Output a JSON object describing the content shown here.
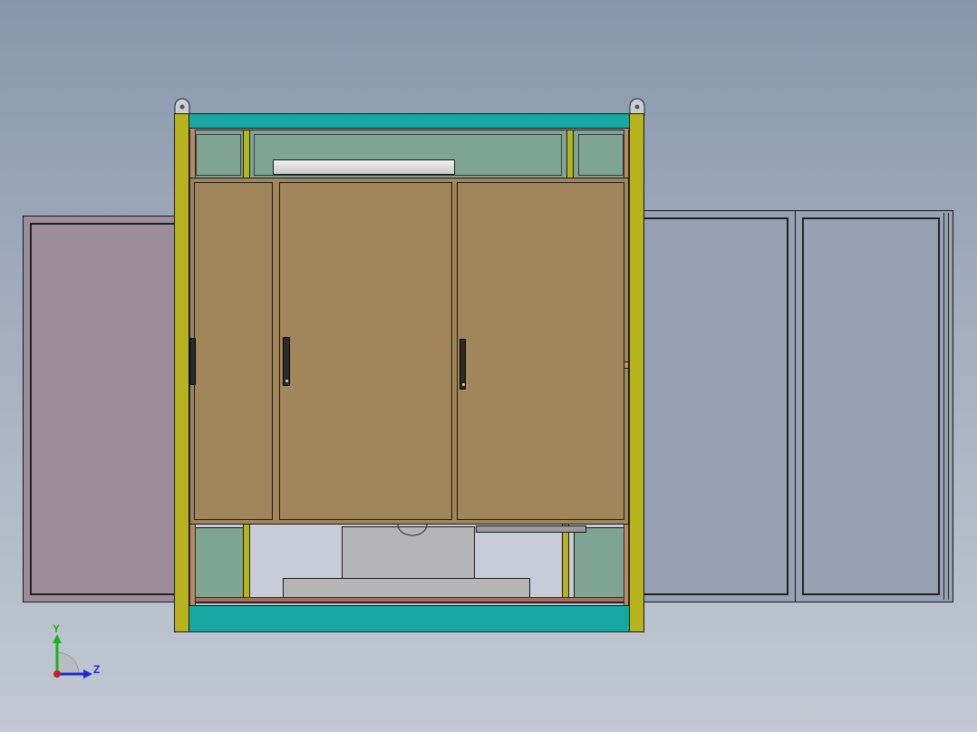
{
  "viewport": {
    "background_top": "#8797ab",
    "background_bottom": "#c2c9d3"
  },
  "model": {
    "frame_color": "#17a8a3",
    "post_color": "#b7b31c",
    "panel_color": "#a2865b",
    "window_color": "#7ea494",
    "left_door_color": "#9c8d99",
    "right_door_color": "#96a1b4",
    "handle_icon": "door-handle-icon",
    "lifting_lug_icon": "lifting-eye-icon"
  },
  "triad": {
    "y_label": "Y",
    "z_label": "Z",
    "y_color": "#1bb21b",
    "z_color": "#1b2bd0",
    "origin_color": "#c0202a"
  }
}
